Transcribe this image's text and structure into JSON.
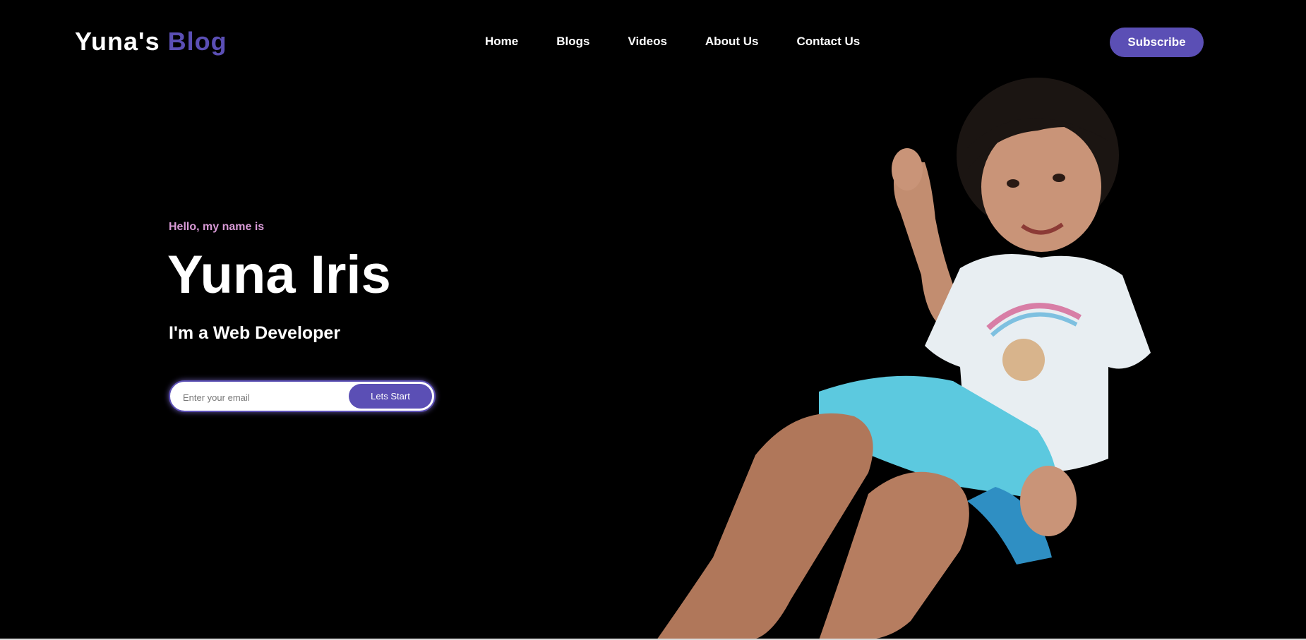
{
  "header": {
    "logo_main": "Yuna's",
    "logo_accent": "Blog",
    "nav": [
      "Home",
      "Blogs",
      "Videos",
      "About Us",
      "Contact Us"
    ],
    "subscribe_label": "Subscribe"
  },
  "hero": {
    "greeting": "Hello, my name is",
    "name": "Yuna Iris",
    "role": "I'm a Web Developer",
    "email_placeholder": "Enter your email",
    "start_label": "Lets Start"
  },
  "colors": {
    "accent": "#5b4fb5",
    "greeting": "#d89ad6",
    "background": "#000000"
  },
  "photo": {
    "icon": "child-portrait-photo"
  }
}
